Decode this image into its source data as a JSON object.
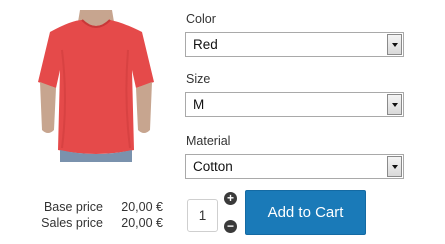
{
  "product": {
    "image_icon": "red-tshirt-model-photo"
  },
  "pricing": {
    "base_label": "Base price",
    "base_value": "20,00 €",
    "sales_label": "Sales price",
    "sales_value": "20,00 €"
  },
  "options": {
    "color": {
      "label": "Color",
      "value": "Red"
    },
    "size": {
      "label": "Size",
      "value": "M"
    },
    "material": {
      "label": "Material",
      "value": "Cotton"
    }
  },
  "quantity": {
    "value": "1",
    "plus_symbol": "+",
    "minus_symbol": "−"
  },
  "cart": {
    "button_label": "Add to Cart",
    "button_color": "#1a7ab8"
  }
}
